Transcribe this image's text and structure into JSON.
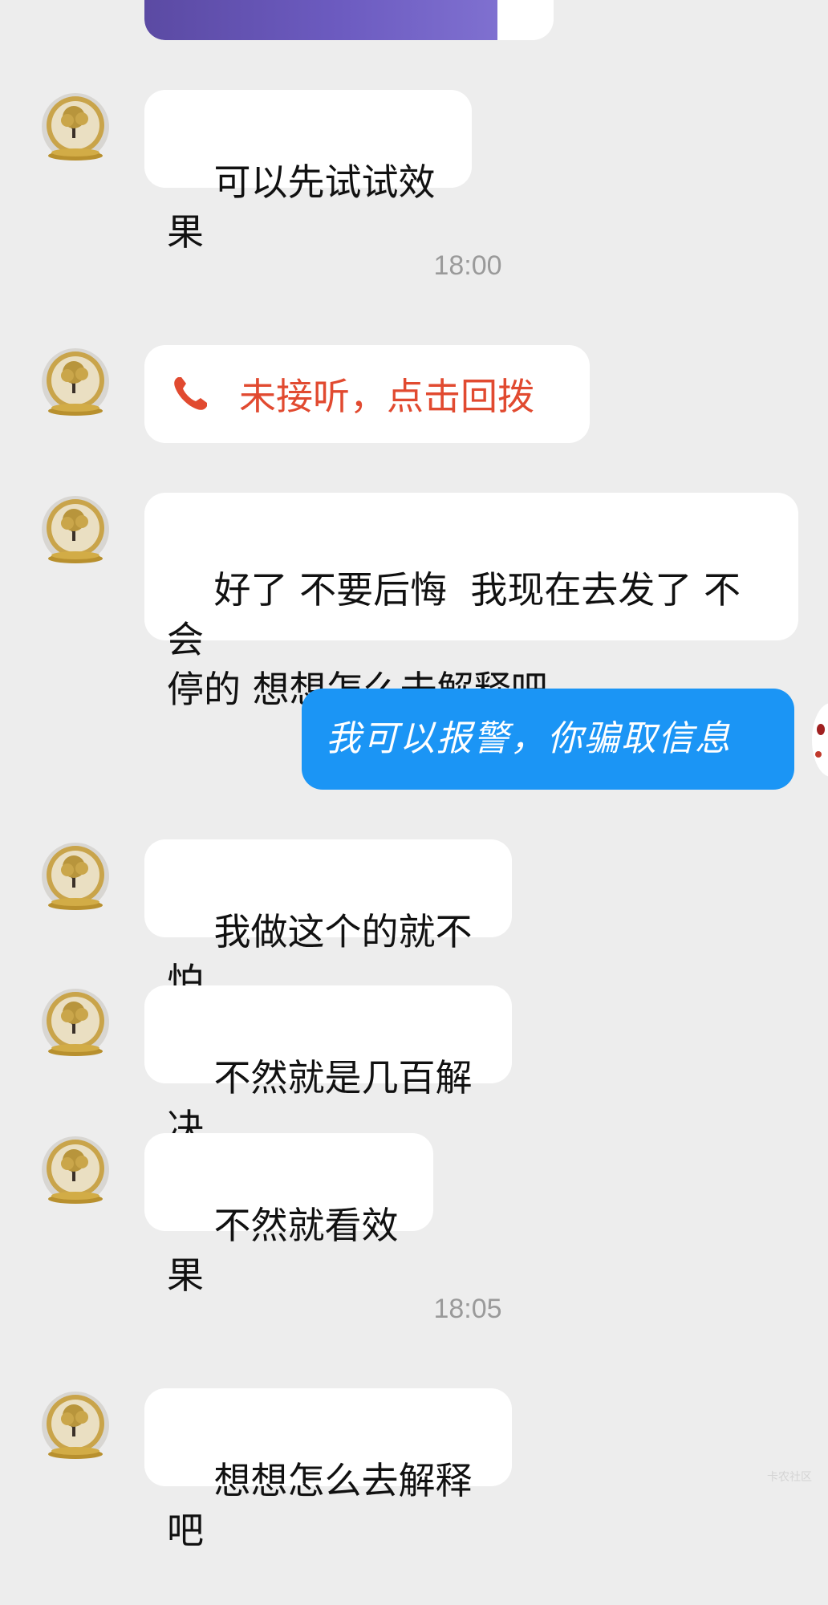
{
  "timestamps": [
    "18:00",
    "18:05"
  ],
  "missed_call": {
    "label": "未接听，点击回拨",
    "icon": "phone-icon"
  },
  "messages": [
    {
      "text": "可以先试试效果"
    },
    {
      "text": "好了 不要后悔  我现在去发了 不会\n停的 想想怎么去解释吧"
    },
    {
      "text": "我可以报警，你骗取信息"
    },
    {
      "text": "我做这个的就不怕"
    },
    {
      "text": "不然就是几百解决"
    },
    {
      "text": "不然就看效果"
    },
    {
      "text": "想想怎么去解释吧"
    }
  ],
  "watermark": "卡农社区",
  "colors": {
    "background": "#ededed",
    "incoming_bubble": "#ffffff",
    "outgoing_bubble": "#1b95f5",
    "missed_call_text": "#e14a30",
    "timestamp_text": "#9a9a9a"
  }
}
